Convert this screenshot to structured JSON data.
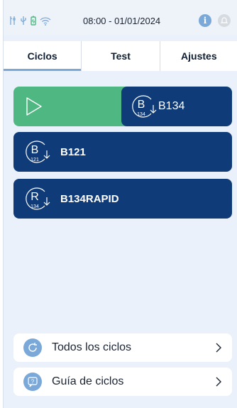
{
  "status": {
    "datetime": "08:00 - 01/01/2024",
    "icons": [
      "tools-icon",
      "usb-icon",
      "battery-icon",
      "wifi-icon"
    ],
    "info_label": "i"
  },
  "tabs": [
    {
      "label": "Ciclos",
      "active": true
    },
    {
      "label": "Test",
      "active": false
    },
    {
      "label": "Ajustes",
      "active": false
    }
  ],
  "selected_cycle": {
    "letter": "B",
    "number": "134",
    "label": "B134"
  },
  "cycles": [
    {
      "letter": "B",
      "number": "121",
      "label": "B121"
    },
    {
      "letter": "R",
      "number": "134",
      "label": "B134RAPID"
    }
  ],
  "rows": [
    {
      "label": "Todos los ciclos",
      "icon": "refresh-icon"
    },
    {
      "label": "Guía de ciclos",
      "icon": "help-chat-icon",
      "icon_glyph": "?"
    }
  ],
  "colors": {
    "navy": "#0f3b78",
    "green": "#4fb882",
    "accent": "#7aa8d8",
    "background": "#eaf1fa"
  }
}
